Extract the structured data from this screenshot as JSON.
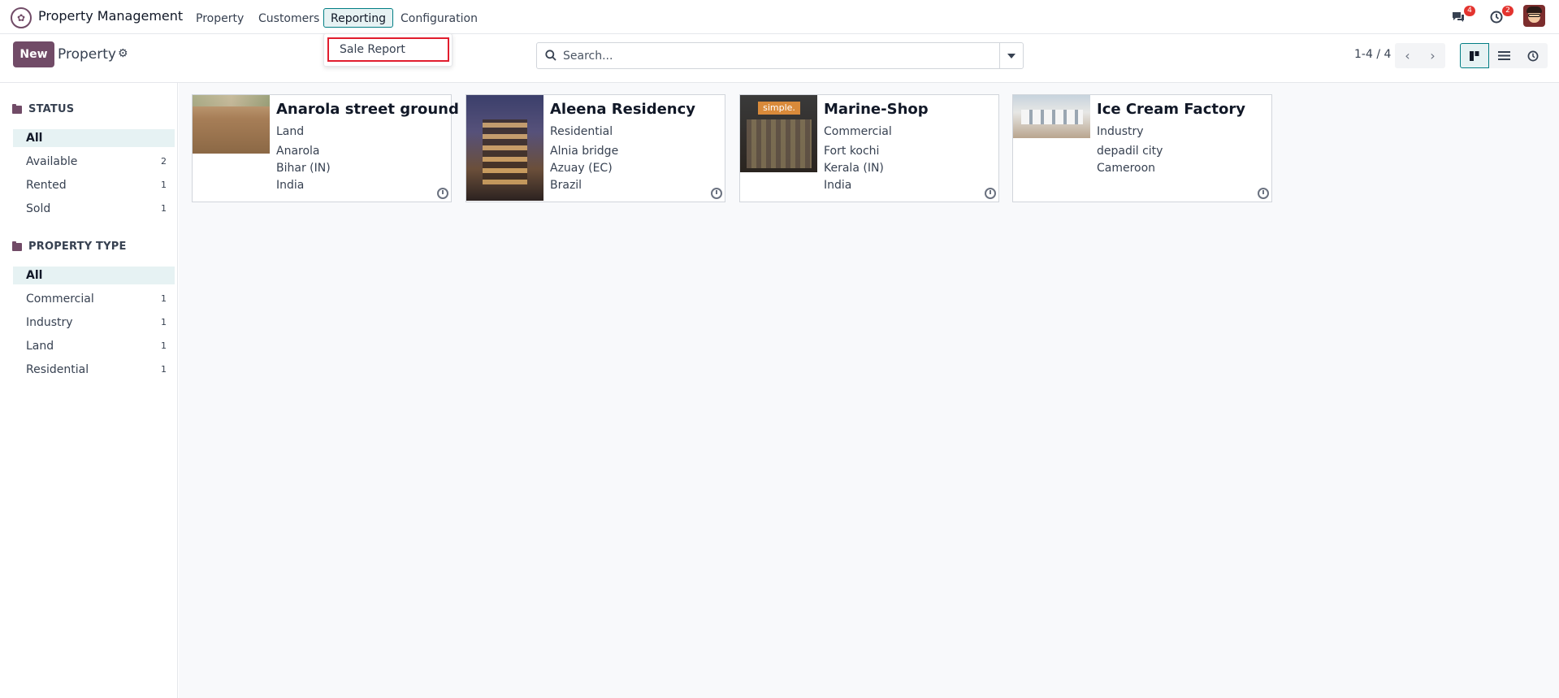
{
  "navbar": {
    "app_name": "Property Management",
    "menus": [
      "Property",
      "Customers",
      "Reporting",
      "Configuration"
    ],
    "messages_badge": "4",
    "activities_badge": "2"
  },
  "reporting_dropdown": {
    "items": [
      "Sale Report"
    ]
  },
  "control_panel": {
    "new_label": "New",
    "title": "Property",
    "search_placeholder": "Search...",
    "pager": "1-4 / 4"
  },
  "sidebar": {
    "status": {
      "title": "STATUS",
      "items": [
        {
          "label": "All",
          "count": ""
        },
        {
          "label": "Available",
          "count": "2"
        },
        {
          "label": "Rented",
          "count": "1"
        },
        {
          "label": "Sold",
          "count": "1"
        }
      ]
    },
    "property_type": {
      "title": "PROPERTY TYPE",
      "items": [
        {
          "label": "All",
          "count": ""
        },
        {
          "label": "Commercial",
          "count": "1"
        },
        {
          "label": "Industry",
          "count": "1"
        },
        {
          "label": "Land",
          "count": "1"
        },
        {
          "label": "Residential",
          "count": "1"
        }
      ]
    }
  },
  "cards": [
    {
      "name": "Anarola street ground",
      "lines": [
        "Land",
        "Anarola",
        "Bihar (IN)",
        "India"
      ]
    },
    {
      "name": "Aleena Residency",
      "lines": [
        "Residential",
        "Alnia bridge",
        "Azuay (EC)",
        "Brazil"
      ]
    },
    {
      "name": "Marine-Shop",
      "lines": [
        "Commercial",
        "Fort kochi",
        "Kerala (IN)",
        "India"
      ],
      "image_text": "simple."
    },
    {
      "name": "Ice Cream Factory",
      "lines": [
        "Industry",
        "depadil city",
        "Cameroon"
      ]
    }
  ],
  "colors": {
    "brand": "#714b67",
    "accent": "#017e84",
    "highlight": "#e11d2e"
  }
}
